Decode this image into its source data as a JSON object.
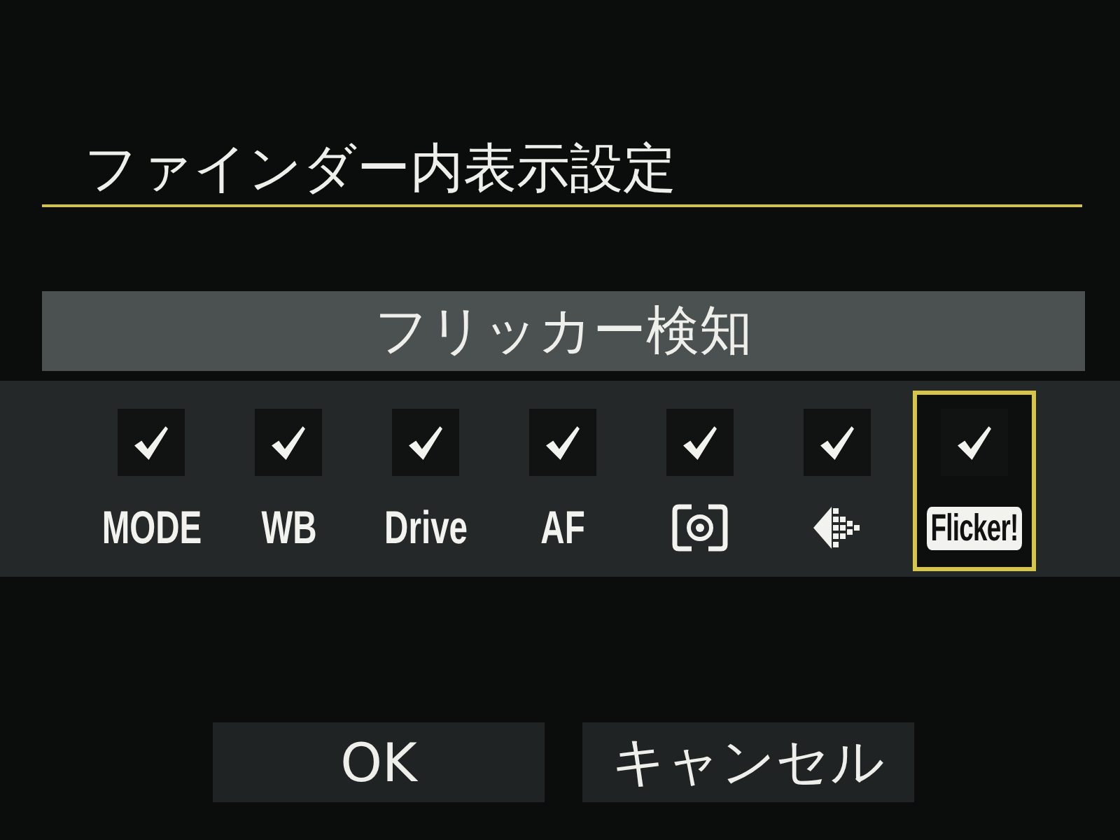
{
  "title": "ファインダー内表示設定",
  "option_name": "フリッカー検知",
  "items": [
    {
      "kind": "text",
      "label": "MODE",
      "checked": true,
      "selected": false
    },
    {
      "kind": "text",
      "label": "WB",
      "checked": true,
      "selected": false
    },
    {
      "kind": "text",
      "label": "Drive",
      "checked": true,
      "selected": false
    },
    {
      "kind": "text",
      "label": "AF",
      "checked": true,
      "selected": false
    },
    {
      "kind": "metering",
      "checked": true,
      "selected": false
    },
    {
      "kind": "arrow",
      "checked": true,
      "selected": false
    },
    {
      "kind": "badge",
      "label": "Flicker!",
      "checked": true,
      "selected": true
    }
  ],
  "buttons": [
    "OK",
    "キャンセル"
  ]
}
